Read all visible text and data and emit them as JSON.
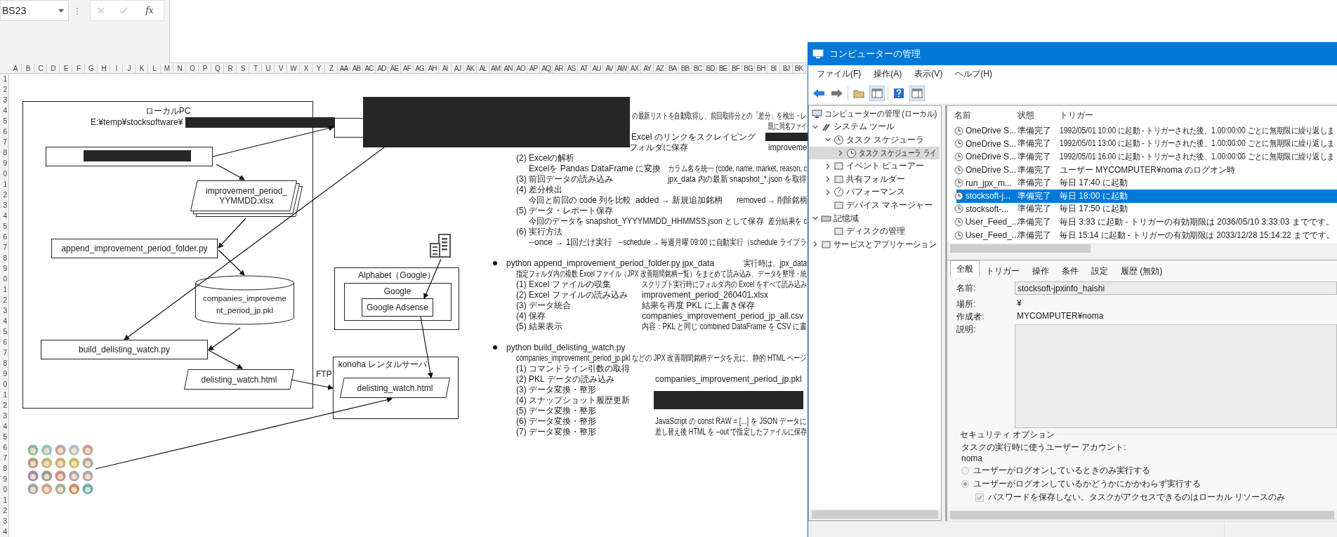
{
  "formula_bar": {
    "name_box": "BS23",
    "function_label": "fx"
  },
  "columns": [
    "A",
    "B",
    "C",
    "D",
    "E",
    "F",
    "G",
    "H",
    "I",
    "J",
    "K",
    "L",
    "M",
    "N",
    "O",
    "P",
    "Q",
    "R",
    "S",
    "T",
    "U",
    "V",
    "W",
    "X",
    "Y",
    "Z",
    "AA",
    "AB",
    "AC",
    "AD",
    "AE",
    "AF",
    "AG",
    "AH",
    "AI",
    "AJ",
    "AK",
    "AL",
    "AM",
    "AN",
    "AO",
    "AP",
    "AQ",
    "AR",
    "AS",
    "AT",
    "AU",
    "AV",
    "AW",
    "AX",
    "AY",
    "AZ",
    "BA",
    "BB",
    "BC",
    "BD",
    "BE",
    "BF",
    "BG",
    "BH",
    "BI",
    "BJ",
    "BK"
  ],
  "row_numbers": [
    "1",
    "2",
    "3",
    "4",
    "5",
    "6",
    "7",
    "8",
    "9",
    "0",
    "1",
    "2",
    "3",
    "4",
    "5",
    "6",
    "7",
    "8",
    "9",
    "0",
    "1",
    "2",
    "3",
    "4",
    "5",
    "6",
    "7",
    "8",
    "9",
    "0",
    "1",
    "2",
    "3",
    "4",
    "5",
    "6",
    "7",
    "8",
    "9",
    "0",
    "1",
    "2",
    "3",
    "4"
  ],
  "diagram": {
    "local_pc": {
      "title": "ローカルPC",
      "path": "E:¥temp¥stocksoftware¥"
    },
    "nodes": [
      {
        "kind": "document",
        "text": "improvement_period_YYMMDD.xlsx"
      },
      {
        "kind": "process",
        "text": "append_improvement_period_folder.py"
      },
      {
        "kind": "database",
        "text": "companies_improvement_period_jp.pkl"
      },
      {
        "kind": "process",
        "text": "build_delisting_watch.py"
      },
      {
        "kind": "data",
        "text": "delisting_watch.html"
      }
    ],
    "alphabet": {
      "title": "Alphabet（Google）",
      "inner_title": "Google",
      "service": "Google Adsense"
    },
    "server": {
      "title": "konoha レンタルサーバ",
      "file": "delisting_watch.html"
    },
    "ftp_label": "FTP"
  },
  "notes": [
    {
      "kind": "line",
      "cells": [
        "の最新リストを自動取得し、前回取得分との「差分」を検出・レ"
      ]
    },
    {
      "kind": "line",
      "cells": [
        "既に同名ファイ"
      ]
    },
    {
      "kind": "line",
      "cells": [
        "Excel のリンクをスクレイピング"
      ]
    },
    {
      "kind": "line",
      "cells": [
        "フォルダに保存",
        "improveme"
      ]
    },
    {
      "kind": "line",
      "cells": [
        "(2) Excelの解析"
      ]
    },
    {
      "kind": "line",
      "cells": [
        "Excelを Pandas DataFrame に変換",
        "カラム名を統一 (code, name, market, reason, c"
      ]
    },
    {
      "kind": "line",
      "cells": [
        "(3) 前回データの読み込み",
        "jpx_data 内の最新 snapshot_*.json を取得"
      ]
    },
    {
      "kind": "line",
      "cells": [
        "(4) 差分検出"
      ]
    },
    {
      "kind": "line",
      "cells": [
        "今回と前回の code 列を比較",
        "added → 新規追加銘柄",
        "removed → 削除銘柄"
      ]
    },
    {
      "kind": "line",
      "cells": [
        "(5) データ・レポート保存"
      ]
    },
    {
      "kind": "line",
      "cells": [
        "今回のデータを snapshot_YYYYMMDD_HHMMSS.json として保存",
        "差分結果を c"
      ]
    },
    {
      "kind": "line",
      "cells": [
        "(6) 実行方法"
      ]
    },
    {
      "kind": "line",
      "cells": [
        "--once → 1回だけ実行",
        "--schedule → 毎週月曜 09:00 に自動実行（schedule ライブラ"
      ]
    },
    {
      "kind": "bullet",
      "cells": [
        "python append_improvement_period_folder.py jpx_data",
        "実行時は、jpx_data"
      ]
    },
    {
      "kind": "line",
      "cells": [
        "指定フォルダ内の複数 Excel ファイル（JPX 改善期間銘柄一覧）をまとめて読み込み、データを整理・統"
      ]
    },
    {
      "kind": "line",
      "cells": [
        "(1) Excel ファイルの収集",
        "スクリプト実行時にフォルダ内の Excel をすべて読み込み"
      ]
    },
    {
      "kind": "line",
      "cells": [
        "(2) Excel ファイルの読み込み",
        "improvement_period_260401.xlsx"
      ]
    },
    {
      "kind": "line",
      "cells": [
        "(3) データ統合",
        "結果を再度 PKL に上書き保存"
      ]
    },
    {
      "kind": "line",
      "cells": [
        "(4) 保存",
        "companies_improvement_period_jp_all.csv"
      ]
    },
    {
      "kind": "line",
      "cells": [
        "(5) 結果表示",
        "内容：PKL と同じ combined DataFrame を CSV に書"
      ]
    },
    {
      "kind": "bullet",
      "cells": [
        "python build_delisting_watch.py"
      ]
    },
    {
      "kind": "line",
      "cells": [
        "companies_improvement_period_jp.pkl などの JPX 改善期間銘柄データを元に、静的 HTML ページ"
      ]
    },
    {
      "kind": "line",
      "cells": [
        "(1) コマンドライン引数の取得"
      ]
    },
    {
      "kind": "line",
      "cells": [
        "(2) PKL データの読み込み",
        "companies_improvement_period_jp.pkl"
      ]
    },
    {
      "kind": "line",
      "cells": [
        "(3) データ変換・整形"
      ]
    },
    {
      "kind": "line",
      "cells": [
        "(4) スナップショット履歴更新"
      ]
    },
    {
      "kind": "line",
      "cells": [
        "(5) データ変換・整形"
      ]
    },
    {
      "kind": "line",
      "cells": [
        "(6) データ変換・整形",
        "JavaScript の const RAW = [...] を JSON データに"
      ]
    },
    {
      "kind": "line",
      "cells": [
        "(7) データ変換・整形",
        "差し替え後 HTML を --out で指定したファイルに保存"
      ]
    }
  ],
  "window": {
    "title": "コンピューターの管理",
    "menu": [
      "ファイル(F)",
      "操作(A)",
      "表示(V)",
      "ヘルプ(H)"
    ],
    "tree": [
      {
        "label": "コンピューターの管理 (ローカル)",
        "selected": false,
        "children": [
          {
            "label": "システム ツール",
            "expanded": true,
            "selected": false,
            "children": [
              {
                "label": "タスク スケジューラ",
                "expanded": true,
                "selected": false,
                "children": [
                  {
                    "label": "タスク スケジューラ ライ",
                    "expanded": false,
                    "selected": true
                  }
                ]
              },
              {
                "label": "イベント ビューアー",
                "expanded": false,
                "selected": false
              },
              {
                "label": "共有フォルダー",
                "expanded": false,
                "selected": false
              },
              {
                "label": "パフォーマンス",
                "expanded": false,
                "selected": false
              },
              {
                "label": "デバイス マネージャー",
                "selected": false
              }
            ]
          },
          {
            "label": "記憶域",
            "expanded": true,
            "selected": false,
            "children": [
              {
                "label": "ディスクの管理",
                "selected": false
              }
            ]
          },
          {
            "label": "サービスとアプリケーション",
            "expanded": false,
            "selected": false
          }
        ]
      }
    ],
    "task_list": {
      "columns": [
        "名前",
        "状態",
        "トリガー"
      ],
      "rows": [
        {
          "name": "OneDrive S...",
          "status": "準備完了",
          "trigger": "1992/05/01 10:00 に起動 - トリガーされた後、1.00:00:00 ごとに無期限に繰り返しま",
          "selected": false
        },
        {
          "name": "OneDrive S...",
          "status": "準備完了",
          "trigger": "1992/05/01 13:00 に起動 - トリガーされた後、1.00:00:00 ごとに無期限に繰り返しま",
          "selected": false
        },
        {
          "name": "OneDrive S...",
          "status": "準備完了",
          "trigger": "1992/05/01 16:00 に起動 - トリガーされた後、1.00:00:00 ごとに無期限に繰り返しま",
          "selected": false
        },
        {
          "name": "OneDrive S...",
          "status": "準備完了",
          "trigger": "ユーザー MYCOMPUTER¥noma のログオン時",
          "selected": false
        },
        {
          "name": "run_jpx_m...",
          "status": "準備完了",
          "trigger": "毎日 17:40 に起動",
          "selected": false
        },
        {
          "name": "stocksoft-j...",
          "status": "準備完了",
          "trigger": "毎日 18:00 に起動",
          "selected": true
        },
        {
          "name": "stocksoft-...",
          "status": "準備完了",
          "trigger": "毎日 17:50 に起動",
          "selected": false
        },
        {
          "name": "User_Feed_...",
          "status": "準備完了",
          "trigger": "毎日 3:33 に起動 - トリガーの有効期限は 2036/05/10 3:33:03 までです。",
          "selected": false
        },
        {
          "name": "User_Feed_...",
          "status": "準備完了",
          "trigger": "毎日 15:14 に起動 - トリガーの有効期限は 2033/12/28 15:14:22 までです。",
          "selected": false
        }
      ]
    },
    "tabs": [
      {
        "label": "全般",
        "selected": true
      },
      {
        "label": "トリガー",
        "selected": false
      },
      {
        "label": "操作",
        "selected": false
      },
      {
        "label": "条件",
        "selected": false
      },
      {
        "label": "設定",
        "selected": false
      },
      {
        "label": "履歴 (無効)",
        "selected": false
      }
    ],
    "fields": [
      {
        "kind": "input",
        "label": "名前:",
        "value": "stocksoft-jpxinfo_haishi"
      },
      {
        "kind": "text",
        "label": "場所:",
        "value": "¥"
      },
      {
        "kind": "text",
        "label": "作成者:",
        "value": "MYCOMPUTER¥noma"
      },
      {
        "kind": "textarea",
        "label": "説明:"
      }
    ],
    "security": {
      "title": "セキュリティ オプション",
      "account_label": "タスクの実行時に使うユーザー アカウント:",
      "account": "noma",
      "options": [
        {
          "label": "ユーザーがログオンしているときのみ実行する",
          "selected": false
        },
        {
          "label": "ユーザーがログオンしているかどうかにかかわらず実行する",
          "selected": true
        }
      ],
      "no_password": {
        "label": "パスワードを保存しない。タスクがアクセスできるのはローカル リソースのみ",
        "checked": true
      }
    }
  }
}
